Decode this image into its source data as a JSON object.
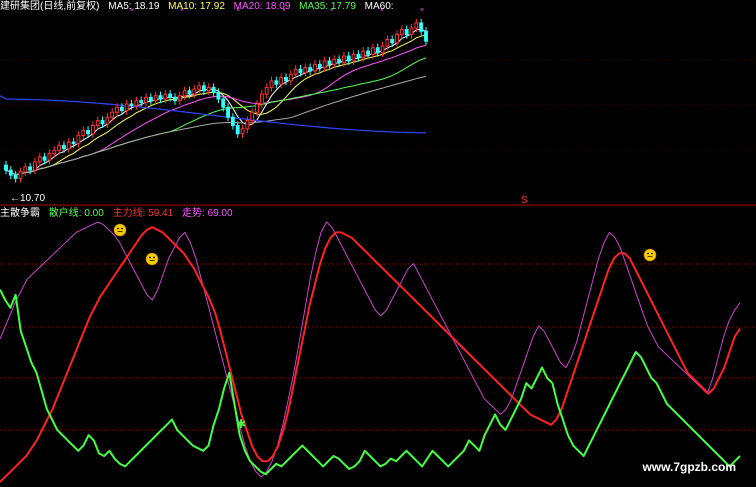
{
  "top_panel": {
    "title": "建研集团(日线,前复权)",
    "ma_labels": [
      {
        "text": "MA5: 18.19",
        "color": "#ffffff"
      },
      {
        "text": "MA10: 17.92",
        "color": "#ffff55"
      },
      {
        "text": "MA20: 18.09",
        "color": "#ff55ff"
      },
      {
        "text": "MA35: 17.79",
        "color": "#55ff55"
      },
      {
        "text": "MA60:",
        "color": "#ffffff"
      }
    ],
    "low_marker": "←10.70",
    "s_marker": "S"
  },
  "bottom_panel": {
    "title": "主散争霸",
    "labels": [
      {
        "text": "散户线: 0.00",
        "color": "#55ff55"
      },
      {
        "text": "主力线: 59.41",
        "color": "#ff3333"
      },
      {
        "text": "走势: 69.00",
        "color": "#ff55ff"
      }
    ]
  },
  "watermark": "www.7gpzb.com",
  "colors": {
    "up_candle": "#ff3333",
    "down_candle": "#33ffff",
    "ma5": "#ffffff",
    "ma10": "#ffff55",
    "ma20": "#ff55ff",
    "ma35": "#55ff55",
    "ma60": "#aaaaaa",
    "long_ma": "#3344ff",
    "main_line": "#ff2222",
    "retail_line": "#44ff44",
    "trend_line": "#cc44cc",
    "separator": "#aa0000"
  },
  "chart_data": [
    {
      "type": "candlestick",
      "title": "建研集团(日线,前复权)",
      "ylim": [
        10.2,
        20.6
      ],
      "series": [
        {
          "name": "MA5",
          "values_ref": "closes_smoothed_5"
        },
        {
          "name": "MA10",
          "values_ref": "closes_smoothed_10"
        },
        {
          "name": "MA20",
          "values_ref": "closes_smoothed_20"
        },
        {
          "name": "MA35",
          "values_ref": "closes_smoothed_35"
        }
      ],
      "closes": [
        11.4,
        11.1,
        10.9,
        11.3,
        11.6,
        11.4,
        11.9,
        12.2,
        12.0,
        12.4,
        12.6,
        12.9,
        12.7,
        13.1,
        13.0,
        13.5,
        13.8,
        13.6,
        14.1,
        14.4,
        14.2,
        14.6,
        14.9,
        15.2,
        15.0,
        15.4,
        15.3,
        15.6,
        15.5,
        15.8,
        15.6,
        15.9,
        15.7,
        16.0,
        15.8,
        15.6,
        15.9,
        16.2,
        16.0,
        16.3,
        16.5,
        16.2,
        16.4,
        16.1,
        15.7,
        15.2,
        14.6,
        14.1,
        13.6,
        13.9,
        14.4,
        14.9,
        15.4,
        16.0,
        16.4,
        16.8,
        16.6,
        17.0,
        16.8,
        17.2,
        17.5,
        17.3,
        17.6,
        17.4,
        17.8,
        17.6,
        18.0,
        17.8,
        18.1,
        17.9,
        18.3,
        18.0,
        18.4,
        18.2,
        18.6,
        18.4,
        18.8,
        18.5,
        18.9,
        19.3,
        19.1,
        19.6,
        19.9,
        19.6,
        20.0,
        20.3,
        19.8,
        19.2
      ],
      "low_label": "←10.70"
    },
    {
      "type": "line",
      "title": "主散争霸",
      "ylim": [
        0,
        100
      ],
      "series": [
        {
          "name": "散户线",
          "values": [
            74,
            70,
            67,
            72,
            58,
            52,
            46,
            42,
            35,
            28,
            24,
            20,
            18,
            16,
            14,
            12,
            14,
            18,
            16,
            11,
            10,
            12,
            9,
            7,
            6,
            8,
            10,
            12,
            14,
            16,
            18,
            20,
            22,
            24,
            20,
            18,
            16,
            14,
            13,
            12,
            14,
            22,
            28,
            36,
            42,
            30,
            18,
            12,
            8,
            6,
            4,
            3,
            5,
            7,
            6,
            8,
            10,
            12,
            14,
            12,
            10,
            8,
            6,
            8,
            10,
            9,
            7,
            5,
            6,
            8,
            12,
            10,
            8,
            6,
            7,
            9,
            8,
            10,
            12,
            10,
            8,
            6,
            9,
            12,
            10,
            8,
            6,
            8,
            10,
            12,
            16,
            14,
            12,
            18,
            22,
            26,
            22,
            20,
            24,
            28,
            32,
            38,
            36,
            40,
            44,
            40,
            38,
            30,
            24,
            18,
            14,
            12,
            10,
            14,
            18,
            22,
            26,
            30,
            34,
            38,
            42,
            46,
            50,
            48,
            44,
            40,
            38,
            34,
            30,
            28,
            26,
            24,
            22,
            20,
            18,
            16,
            14,
            12,
            10,
            8,
            6,
            8,
            10
          ]
        },
        {
          "name": "主力线",
          "values": [
            0,
            2,
            4,
            6,
            8,
            10,
            13,
            16,
            20,
            24,
            28,
            33,
            38,
            43,
            48,
            53,
            58,
            63,
            67,
            71,
            74,
            77,
            80,
            83,
            86,
            89,
            92,
            95,
            97,
            98,
            97,
            96,
            94,
            92,
            90,
            88,
            85,
            82,
            78,
            74,
            70,
            65,
            58,
            50,
            42,
            34,
            26,
            20,
            14,
            10,
            8,
            8,
            10,
            14,
            20,
            28,
            38,
            48,
            58,
            68,
            76,
            84,
            90,
            94,
            96,
            96,
            95,
            94,
            92,
            90,
            88,
            86,
            84,
            82,
            80,
            78,
            76,
            74,
            72,
            70,
            68,
            66,
            64,
            62,
            60,
            58,
            56,
            54,
            52,
            50,
            48,
            46,
            44,
            42,
            40,
            38,
            36,
            34,
            32,
            30,
            28,
            26,
            25,
            24,
            23,
            22,
            24,
            28,
            34,
            40,
            46,
            52,
            58,
            64,
            70,
            76,
            82,
            86,
            88,
            88,
            86,
            82,
            78,
            74,
            70,
            66,
            62,
            58,
            54,
            50,
            46,
            42,
            40,
            38,
            36,
            34,
            36,
            40,
            44,
            50,
            56,
            59
          ]
        },
        {
          "name": "走势",
          "values": [
            55,
            60,
            65,
            70,
            74,
            78,
            80,
            82,
            84,
            86,
            88,
            90,
            92,
            94,
            96,
            97,
            98,
            99,
            100,
            99,
            97,
            95,
            92,
            88,
            84,
            80,
            76,
            72,
            70,
            74,
            80,
            86,
            90,
            94,
            96,
            92,
            86,
            78,
            70,
            62,
            54,
            46,
            38,
            30,
            22,
            14,
            8,
            4,
            2,
            4,
            8,
            14,
            22,
            32,
            42,
            54,
            66,
            78,
            88,
            96,
            100,
            98,
            94,
            90,
            86,
            82,
            78,
            74,
            70,
            66,
            64,
            66,
            70,
            74,
            78,
            82,
            84,
            80,
            76,
            72,
            68,
            64,
            60,
            56,
            52,
            48,
            44,
            40,
            36,
            32,
            30,
            28,
            26,
            28,
            32,
            38,
            44,
            50,
            56,
            60,
            58,
            54,
            50,
            46,
            44,
            48,
            54,
            62,
            70,
            78,
            86,
            92,
            96,
            94,
            90,
            84,
            78,
            72,
            66,
            60,
            56,
            52,
            50,
            48,
            46,
            44,
            42,
            40,
            38,
            36,
            34,
            40,
            48,
            56,
            62,
            66,
            69
          ]
        }
      ]
    }
  ]
}
